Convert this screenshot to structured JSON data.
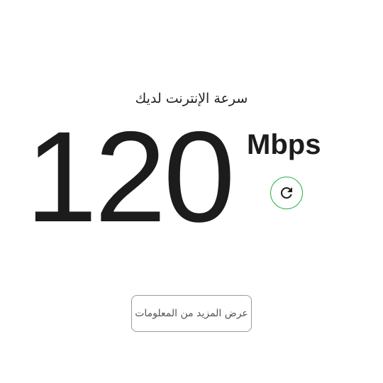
{
  "speed_test": {
    "label": "سرعة الإنترنت لديك",
    "value": "120",
    "unit": "Mbps",
    "refresh_icon": "refresh-icon",
    "accent_color": "#2bb24c"
  },
  "actions": {
    "more_info_label": "عرض المزيد من المعلومات"
  }
}
